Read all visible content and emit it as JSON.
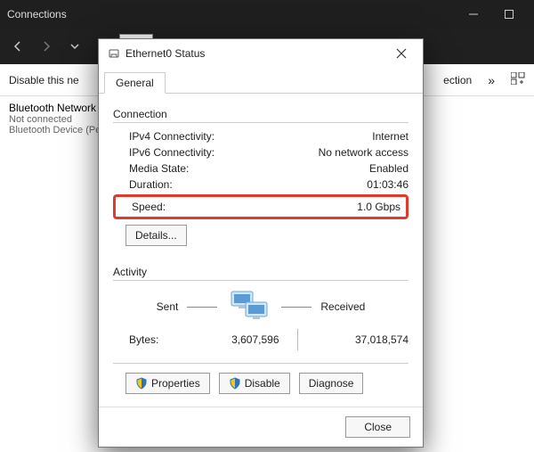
{
  "parent_title": "Connections",
  "cmd": {
    "disable": "Disable this ne",
    "right1": "ection",
    "overflow": "»"
  },
  "breadcrumb": {
    "chevrons": "«"
  },
  "adapter": {
    "title": "Bluetooth Network C",
    "status": "Not connected",
    "device": "Bluetooth Device (Per"
  },
  "dialog": {
    "title": "Ethernet0 Status",
    "tab_general": "General",
    "groups": {
      "connection": "Connection",
      "activity": "Activity"
    },
    "rows": {
      "ipv4_k": "IPv4 Connectivity:",
      "ipv4_v": "Internet",
      "ipv6_k": "IPv6 Connectivity:",
      "ipv6_v": "No network access",
      "media_k": "Media State:",
      "media_v": "Enabled",
      "dur_k": "Duration:",
      "dur_v": "01:03:46",
      "speed_k": "Speed:",
      "speed_v": "1.0 Gbps"
    },
    "details_btn": "Details...",
    "activity": {
      "sent_label": "Sent",
      "recv_label": "Received",
      "bytes_label": "Bytes:",
      "sent_val": "3,607,596",
      "recv_val": "37,018,574"
    },
    "buttons": {
      "properties": "Properties",
      "disable": "Disable",
      "diagnose": "Diagnose",
      "close": "Close"
    }
  }
}
